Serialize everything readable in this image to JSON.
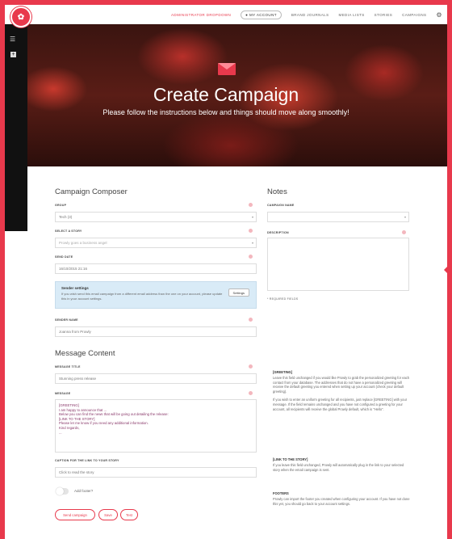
{
  "nav": {
    "admin": "ADMINISTRATOR DROPDOWN",
    "account": "MY ACCOUNT",
    "brand_journals": "BRAND JOURNALS",
    "media_lists": "MEDIA LISTS",
    "stories": "STORIES",
    "campaigns": "CAMPAIGNS"
  },
  "hero": {
    "title": "Create Campaign",
    "subtitle": "Please follow the instructions below and things should move along smoothly!"
  },
  "composer": {
    "heading": "Campaign Composer",
    "group_label": "GROUP",
    "group_value": "Tech (3)",
    "story_label": "SELECT A STORY",
    "story_value": "Prowly goes a business angel",
    "send_date_label": "SEND DATE",
    "send_date_value": "16/10/2015 21:16",
    "sender_settings_title": "Sender settings",
    "sender_settings_text": "If you wish send this email campaign from a different email address than the one on your account, please update this in your account settings.",
    "settings_button": "Settings",
    "sender_name_label": "SENDER NAME",
    "sender_name_value": "Joanna from Prowly"
  },
  "message": {
    "heading": "Message Content",
    "title_label": "MESSAGE TITLE",
    "title_value": "Stunning press release",
    "message_label": "MESSAGE",
    "body": [
      "[GREETING]",
      "I am happy to announce that ...",
      "Below you can find the news that will be going out detailing the release:",
      "[LINK TO THE STORY]",
      "Please let me know if you need any additional information.",
      "Kind regards,",
      "..."
    ],
    "caption_label": "CAPTION FOR THE LINK TO YOUR STORY",
    "caption_value": "Click to read the story",
    "footer_toggle": "Add footer?"
  },
  "actions": {
    "send": "Send campaign",
    "save": "Save",
    "test": "Test"
  },
  "notes": {
    "heading": "Notes",
    "campaign_name_label": "CAMPAIGN NAME",
    "description_label": "DESCRIPTION",
    "required": "* REQUIRED FIELDS"
  },
  "help": {
    "greeting_title": "[GREETING]",
    "greeting_p1": "Leave this field unchanged if you would like Prowly to grab the personalized greeting for each contact from your database. The addresses that do not have a personalized greeting will receive the default greeting you entered when setting up your account (check your default greeting).",
    "greeting_p2": "If you wish to enter an uniform greeting for all recipients, just replace [GREETING] with your message. If the field remains unchanged and you have not configured a greeting for your account, all recipients will receive the global Prowly default, which is \"Hello\".",
    "link_title": "[LINK TO THE STORY]",
    "link_text": "If you leave this field unchanged, Prowly will automatically plug in the link to your selected story when the email campaign is sent.",
    "footers_title": "FOOTERS",
    "footers_text": "Prowly can import the footer you created when configuring your account. If you have not done this yet, you should go back to your account settings."
  }
}
